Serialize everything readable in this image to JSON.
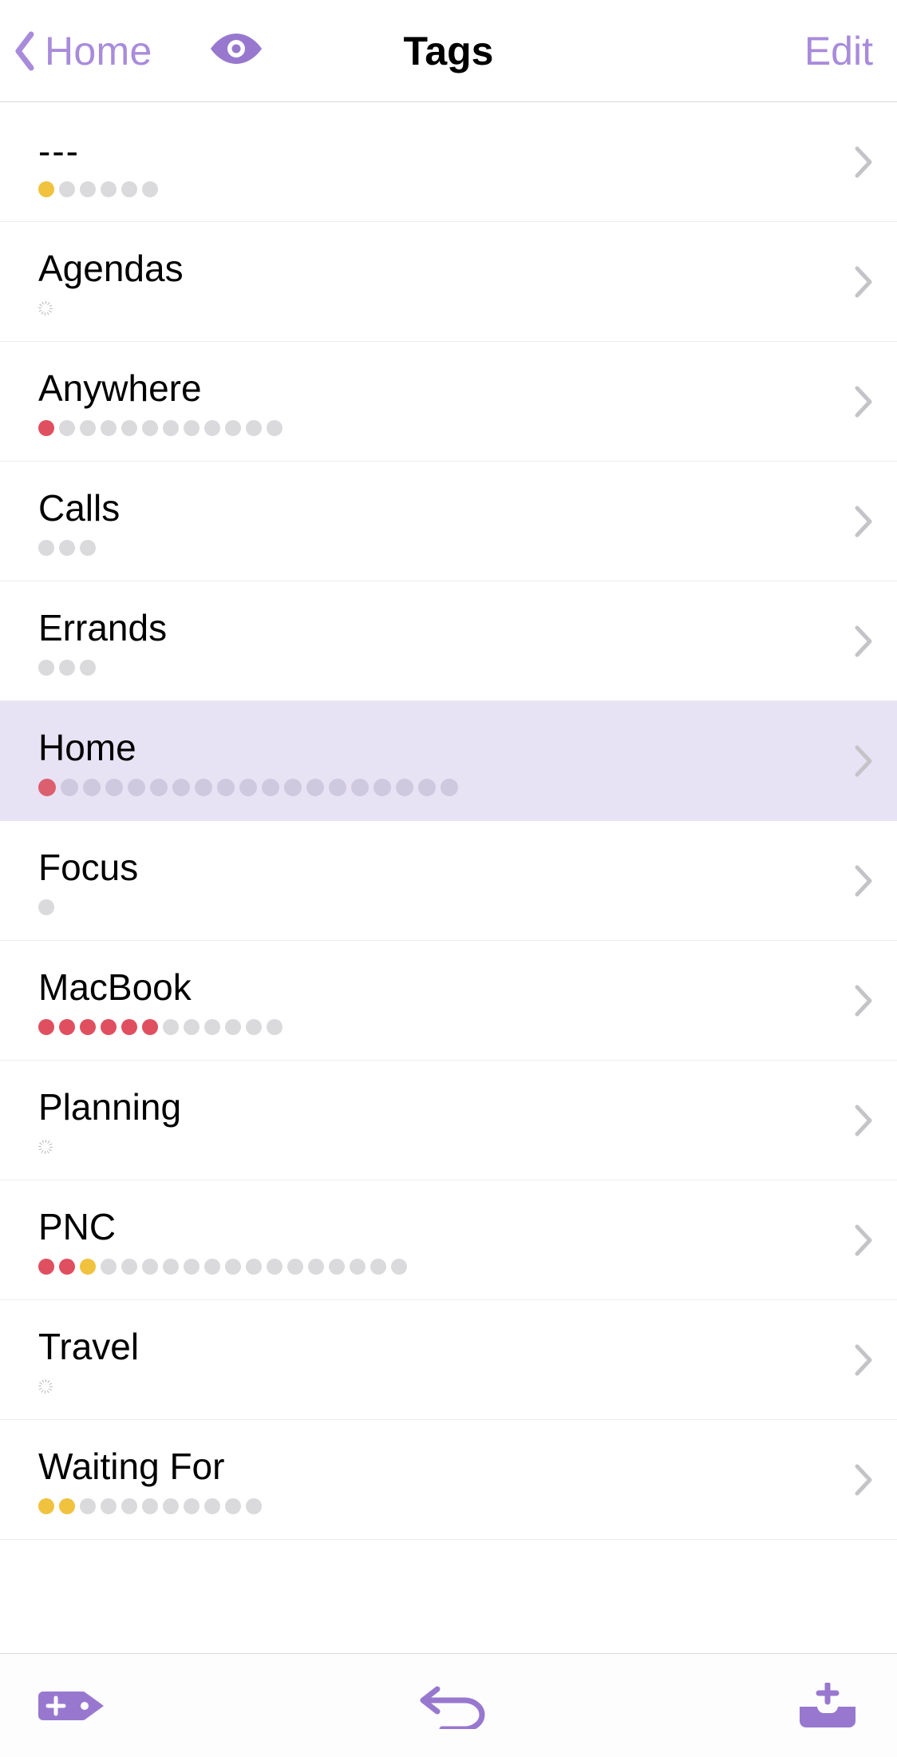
{
  "header": {
    "back_label": "Home",
    "title": "Tags",
    "edit_label": "Edit"
  },
  "colors": {
    "accent": "#A98BDB",
    "chevron": "#C4C4C8",
    "red": "#e04f5f",
    "yellow": "#f0c23d",
    "gray": "#dadadd",
    "selected_bg": "#E8E2F5"
  },
  "tags": [
    {
      "label": "---",
      "dots": [
        "yellow",
        "gray",
        "gray",
        "gray",
        "gray",
        "gray"
      ],
      "spinner": false,
      "selected": false,
      "dash": true
    },
    {
      "label": "Agendas",
      "dots": [],
      "spinner": true,
      "selected": false
    },
    {
      "label": "Anywhere",
      "dots": [
        "red",
        "gray",
        "gray",
        "gray",
        "gray",
        "gray",
        "gray",
        "gray",
        "gray",
        "gray",
        "gray",
        "gray"
      ],
      "spinner": false,
      "selected": false
    },
    {
      "label": "Calls",
      "dots": [
        "gray",
        "gray",
        "gray"
      ],
      "spinner": false,
      "selected": false
    },
    {
      "label": "Errands",
      "dots": [
        "gray",
        "gray",
        "gray"
      ],
      "spinner": false,
      "selected": false
    },
    {
      "label": "Home",
      "dots": [
        "red",
        "gray",
        "gray",
        "gray",
        "gray",
        "gray",
        "gray",
        "gray",
        "gray",
        "gray",
        "gray",
        "gray",
        "gray",
        "gray",
        "gray",
        "gray",
        "gray",
        "gray",
        "gray"
      ],
      "spinner": false,
      "selected": true,
      "home_style": true
    },
    {
      "label": "Focus",
      "dots": [
        "gray"
      ],
      "spinner": false,
      "selected": false
    },
    {
      "label": "MacBook",
      "dots": [
        "red",
        "red",
        "red",
        "red",
        "red",
        "red",
        "gray",
        "gray",
        "gray",
        "gray",
        "gray",
        "gray"
      ],
      "spinner": false,
      "selected": false
    },
    {
      "label": "Planning",
      "dots": [],
      "spinner": true,
      "selected": false
    },
    {
      "label": "PNC",
      "dots": [
        "red",
        "red",
        "yellow",
        "gray",
        "gray",
        "gray",
        "gray",
        "gray",
        "gray",
        "gray",
        "gray",
        "gray",
        "gray",
        "gray",
        "gray",
        "gray",
        "gray",
        "gray"
      ],
      "spinner": false,
      "selected": false
    },
    {
      "label": "Travel",
      "dots": [],
      "spinner": true,
      "selected": false
    },
    {
      "label": "Waiting For",
      "dots": [
        "yellow",
        "yellow",
        "gray",
        "gray",
        "gray",
        "gray",
        "gray",
        "gray",
        "gray",
        "gray",
        "gray"
      ],
      "spinner": false,
      "selected": false
    }
  ],
  "toolbar": {
    "new_tag": "new-tag-button",
    "undo": "undo-button",
    "inbox": "add-to-inbox-button"
  }
}
